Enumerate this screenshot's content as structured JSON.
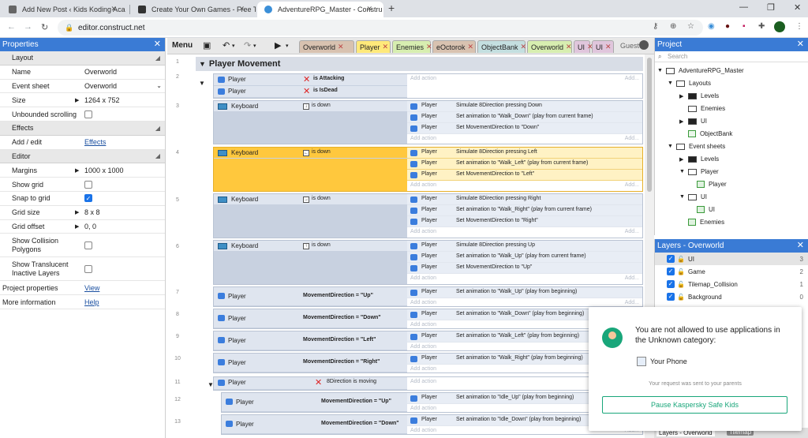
{
  "browser": {
    "tabs": [
      {
        "title": "Add New Post ‹ Kids Koding Aca"
      },
      {
        "title": "Create Your Own Games - Free T"
      },
      {
        "title": "AdventureRPG_Master - Constru"
      }
    ],
    "url": "editor.construct.net"
  },
  "properties": {
    "title": "Properties",
    "sections": {
      "layout": "Layout",
      "effects": "Effects",
      "editor": "Editor"
    },
    "rows": {
      "name_k": "Name",
      "name_v": "Overworld",
      "evsheet_k": "Event sheet",
      "evsheet_v": "Overworld",
      "size_k": "Size",
      "size_v": "1264 x 752",
      "unbounded_k": "Unbounded scrolling",
      "addedit_k": "Add / edit",
      "addedit_v": "Effects",
      "margins_k": "Margins",
      "margins_v": "1000 x 1000",
      "showgrid_k": "Show grid",
      "snap_k": "Snap to grid",
      "gridsize_k": "Grid size",
      "gridsize_v": "8 x 8",
      "gridoff_k": "Grid offset",
      "gridoff_v": "0, 0",
      "collision_k": "Show Collision Polygons",
      "translucent_k": "Show Translucent Inactive Layers",
      "projprops_k": "Project properties",
      "projprops_v": "View",
      "moreinfo_k": "More information",
      "moreinfo_v": "Help"
    }
  },
  "toolbar": {
    "menu": "Menu",
    "guest": "Guest",
    "tabs": [
      "Overworld",
      "Player",
      "Enemies",
      "eOctorok",
      "ObjectBank",
      "Overworld",
      "UI",
      "UI"
    ]
  },
  "sheet": {
    "group_title": "Player Movement",
    "add_action": "Add action",
    "add_more": "Add...",
    "line_numbers": [
      "1",
      "2",
      "3",
      "4",
      "5",
      "6",
      "7",
      "8",
      "9",
      "10",
      "11",
      "12",
      "13"
    ],
    "events": [
      {
        "conds": [
          {
            "obj": "Player",
            "text": "is Attacking"
          },
          {
            "obj": "Player",
            "text": "is IsDead"
          }
        ],
        "actions": []
      },
      {
        "conds": [
          {
            "obj": "Keyboard",
            "text": "is down"
          }
        ],
        "actions": [
          {
            "obj": "Player",
            "text": "Simulate 8Direction pressing Down"
          },
          {
            "obj": "Player",
            "text": "Set animation to \"Walk_Down\" (play from current frame)"
          },
          {
            "obj": "Player",
            "text": "Set MovementDirection to \"Down\""
          }
        ]
      },
      {
        "conds": [
          {
            "obj": "Keyboard",
            "text": "is down"
          }
        ],
        "actions": [
          {
            "obj": "Player",
            "text": "Simulate 8Direction pressing Left"
          },
          {
            "obj": "Player",
            "text": "Set animation to \"Walk_Left\" (play from current frame)"
          },
          {
            "obj": "Player",
            "text": "Set MovementDirection to \"Left\""
          }
        ]
      },
      {
        "conds": [
          {
            "obj": "Keyboard",
            "text": "is down"
          }
        ],
        "actions": [
          {
            "obj": "Player",
            "text": "Simulate 8Direction pressing Right"
          },
          {
            "obj": "Player",
            "text": "Set animation to \"Walk_Right\" (play from current frame)"
          },
          {
            "obj": "Player",
            "text": "Set MovementDirection to \"Right\""
          }
        ]
      },
      {
        "conds": [
          {
            "obj": "Keyboard",
            "text": "is down"
          }
        ],
        "actions": [
          {
            "obj": "Player",
            "text": "Simulate 8Direction pressing Up"
          },
          {
            "obj": "Player",
            "text": "Set animation to \"Walk_Up\" (play from current frame)"
          },
          {
            "obj": "Player",
            "text": "Set MovementDirection to \"Up\""
          }
        ]
      },
      {
        "conds": [
          {
            "obj": "Player",
            "text": "MovementDirection = \"Up\""
          }
        ],
        "actions": [
          {
            "obj": "Player",
            "text": "Set animation to \"Walk_Up\" (play from beginning)"
          }
        ]
      },
      {
        "conds": [
          {
            "obj": "Player",
            "text": "MovementDirection = \"Down\""
          }
        ],
        "actions": [
          {
            "obj": "Player",
            "text": "Set animation to \"Walk_Down\" (play from beginning)"
          }
        ]
      },
      {
        "conds": [
          {
            "obj": "Player",
            "text": "MovementDirection = \"Left\""
          }
        ],
        "actions": [
          {
            "obj": "Player",
            "text": "Set animation to \"Walk_Left\" (play from beginning)"
          }
        ]
      },
      {
        "conds": [
          {
            "obj": "Player",
            "text": "MovementDirection = \"Right\""
          }
        ],
        "actions": [
          {
            "obj": "Player",
            "text": "Set animation to \"Walk_Right\" (play from beginning)"
          }
        ]
      },
      {
        "conds": [
          {
            "obj": "Player",
            "text": "8Direction is moving"
          }
        ],
        "actions": []
      },
      {
        "conds": [
          {
            "obj": "Player",
            "text": "MovementDirection = \"Up\""
          }
        ],
        "actions": [
          {
            "obj": "Player",
            "text": "Set animation to \"Idle_Up\" (play from beginning)"
          }
        ]
      },
      {
        "conds": [
          {
            "obj": "Player",
            "text": "MovementDirection = \"Down\""
          }
        ],
        "actions": [
          {
            "obj": "Player",
            "text": "Set animation to \"Idle_Down\" (play from beginning)"
          }
        ]
      }
    ]
  },
  "project": {
    "title": "Project",
    "search": "Search",
    "tree": [
      "AdventureRPG_Master",
      "Layouts",
      "Levels",
      "Enemies",
      "UI",
      "ObjectBank",
      "Event sheets",
      "Levels",
      "Player",
      "Player",
      "UI",
      "UI",
      "Enemies"
    ]
  },
  "layers": {
    "title": "Layers - Overworld",
    "items": [
      {
        "name": "UI",
        "n": "3"
      },
      {
        "name": "Game",
        "n": "2"
      },
      {
        "name": "Tilemap_Collision",
        "n": "1"
      },
      {
        "name": "Background",
        "n": "0"
      }
    ],
    "bottom_tabs": [
      "Layers - Overworld",
      "Tilemap"
    ]
  },
  "popup": {
    "message": "You are not allowed to use applications in the Unknown category:",
    "app": "Your Phone",
    "sent": "Your request was sent to your parents",
    "button": "Pause Kaspersky Safe Kids"
  },
  "colors": {
    "accent": "#3a7bd5",
    "selected": "#ffc83d",
    "kaspersky": "#19a67a"
  }
}
